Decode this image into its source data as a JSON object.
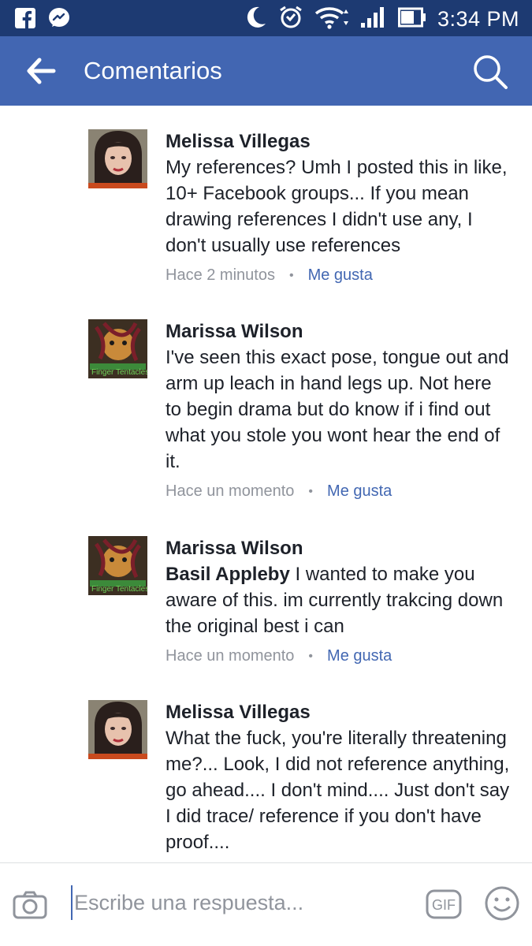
{
  "status_bar": {
    "time": "3:34 PM",
    "left_icons": [
      "facebook-icon",
      "messenger-icon"
    ],
    "right_icons": [
      "moon-icon",
      "alarm-icon",
      "wifi-icon",
      "signal-icon",
      "battery-icon"
    ]
  },
  "header": {
    "title": "Comentarios",
    "back_icon": "back-arrow-icon",
    "search_icon": "search-icon",
    "color": "#4266b2"
  },
  "comments": [
    {
      "author": "Melissa Villegas",
      "mention": "",
      "text": "My references? Umh I posted this in like, 10+ Facebook groups... If you mean drawing references I didn't use any, I don't usually use references",
      "time": "Hace 2 minutos",
      "like": "Me gusta"
    },
    {
      "author": "Marissa Wilson",
      "mention": "",
      "text": "I've seen this exact pose, tongue out and arm up leach in hand legs up. Not here to begin drama but do know if i find out what you stole you wont hear the end of it.",
      "time": "Hace un momento",
      "like": "Me gusta",
      "avatar_caption": "Finger Tentacles"
    },
    {
      "author": "Marissa Wilson",
      "mention": "Basil Appleby",
      "text": " I wanted to make you aware of this. im currently trakcing down the original best i can",
      "time": "Hace un momento",
      "like": "Me gusta",
      "avatar_caption": "Finger Tentacles"
    },
    {
      "author": "Melissa Villegas",
      "mention": "",
      "text": "What the fuck, you're literally threatening me?... Look, I did not reference anything, go ahead.... I don't mind.... Just don't say I did trace/ reference if you don't have proof....",
      "time": "",
      "like": ""
    }
  ],
  "composer": {
    "placeholder": "Escribe una respuesta...",
    "camera_icon": "camera-icon",
    "gif_label": "GIF",
    "emoji_icon": "emoji-icon"
  }
}
